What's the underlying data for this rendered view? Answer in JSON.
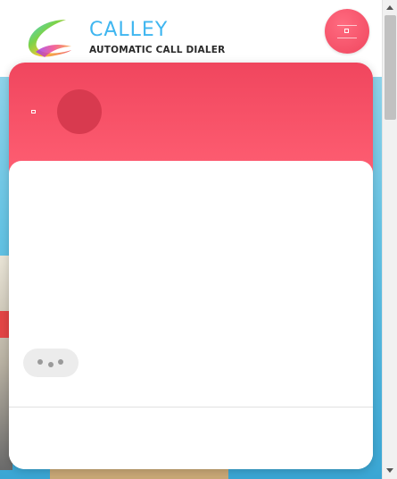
{
  "header": {
    "brand_name": "CALLEY",
    "brand_tagline": "AUTOMATIC CALL DIALER",
    "logo_icon": "calley-logo-icon",
    "menu_icon": "hamburger-menu-icon"
  },
  "chat_widget": {
    "back_icon": "back-icon",
    "typing_indicator": "typing-dots"
  },
  "colors": {
    "accent": "#f0465e",
    "brand_blue": "#3fb6f0"
  }
}
